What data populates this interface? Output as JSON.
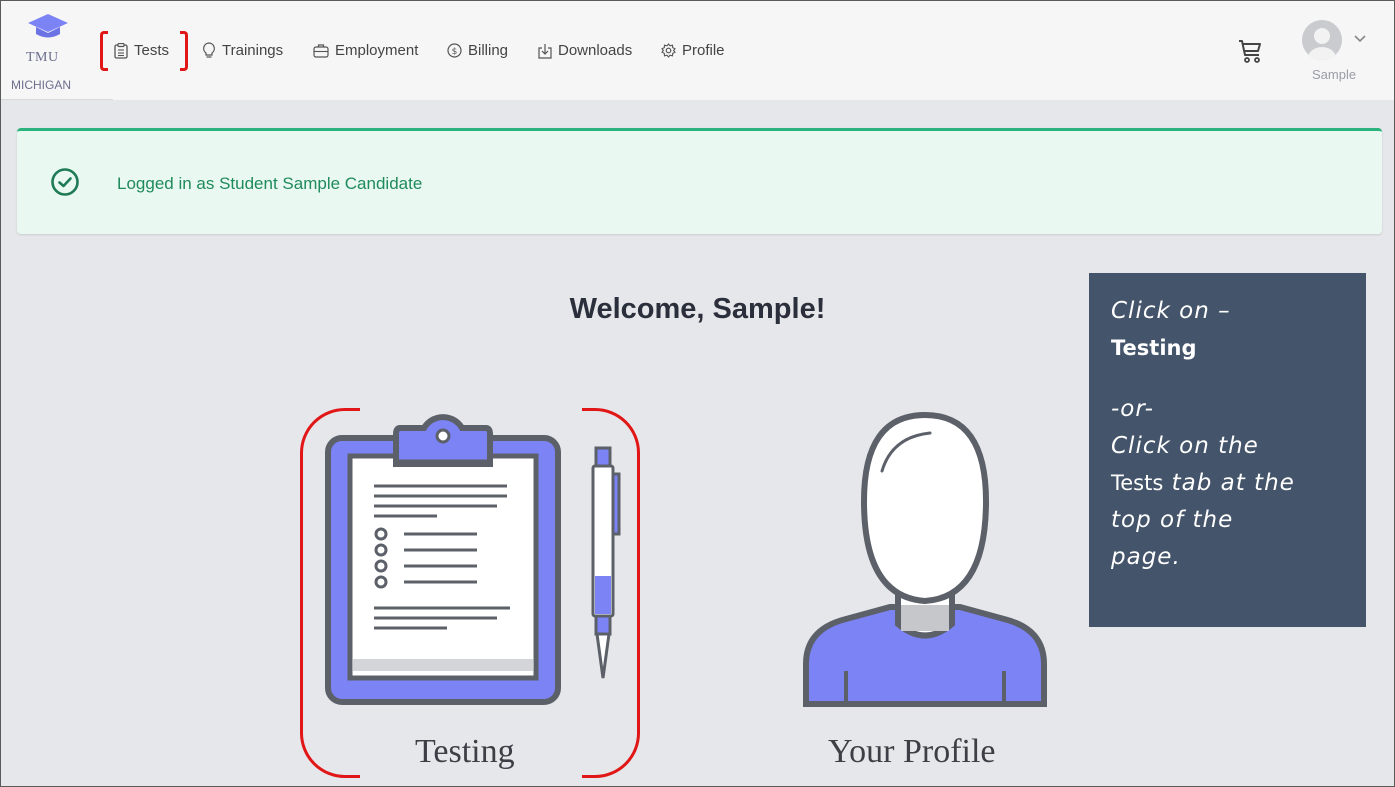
{
  "app": {
    "logo_text": "TMU",
    "logo_subtext": "MICHIGAN"
  },
  "nav": {
    "items": [
      {
        "label": "Tests",
        "icon": "clipboard-icon"
      },
      {
        "label": "Trainings",
        "icon": "lightbulb-icon"
      },
      {
        "label": "Employment",
        "icon": "briefcase-icon"
      },
      {
        "label": "Billing",
        "icon": "dollar-icon"
      },
      {
        "label": "Downloads",
        "icon": "download-icon"
      },
      {
        "label": "Profile",
        "icon": "gear-icon"
      }
    ]
  },
  "user": {
    "name": "Sample",
    "icons": [
      "cart-icon",
      "avatar",
      "chevron-down-icon"
    ]
  },
  "alert": {
    "message": "Logged in as Student Sample Candidate",
    "icon": "check-circle-icon",
    "color": "#2bb37d"
  },
  "main": {
    "welcome": "Welcome, Sample!",
    "cards": [
      {
        "label": "Testing",
        "icon": "clipboard-pen-illustration"
      },
      {
        "label": "Your Profile",
        "icon": "person-illustration"
      }
    ]
  },
  "callout": {
    "line1": "Click on –",
    "line2": "Testing",
    "line3": "-or-",
    "line4": "Click on the",
    "line5_bold": "Tests",
    "line5_rest": " tab at the",
    "line6": "top of the",
    "line7": "page.",
    "background": "#44546a"
  },
  "highlight_color": "#e11616",
  "accent_color": "#7c83f5"
}
